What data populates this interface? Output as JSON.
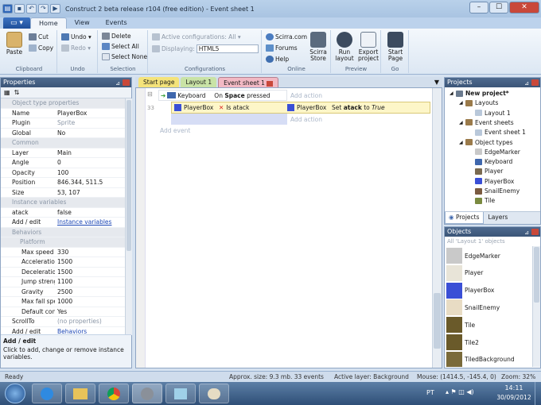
{
  "titlebar": {
    "title": "Construct 2 beta release r104  (free edition) - Event sheet 1",
    "minimize": "–",
    "maximize": "☐",
    "close": "✕"
  },
  "tabs": {
    "file": "▭ ▾",
    "items": [
      "Home",
      "View",
      "Events"
    ],
    "active": "Home"
  },
  "ribbon": {
    "clipboard": {
      "paste": "Paste",
      "cut": "Cut",
      "copy": "Copy",
      "label": "Clipboard"
    },
    "undo": {
      "undo": "Undo",
      "redo": "Redo",
      "label": "Undo"
    },
    "selection": {
      "delete": "Delete",
      "select_all": "Select All",
      "select_none": "Select None",
      "label": "Selection"
    },
    "configurations": {
      "active": "Active configurations: All",
      "displaying_label": "Displaying:",
      "displaying_value": "HTML5",
      "label": "Configurations"
    },
    "online": {
      "scirra": "Scirra.com",
      "forums": "Forums",
      "help": "Help",
      "store1": "Scirra",
      "store2": "Store",
      "label": "Online"
    },
    "preview": {
      "run1": "Run",
      "run2": "layout",
      "export1": "Export",
      "export2": "project",
      "label": "Preview"
    },
    "go": {
      "start1": "Start",
      "start2": "Page",
      "label": "Go"
    }
  },
  "properties": {
    "title": "Properties",
    "rows": [
      {
        "type": "cat",
        "k": "Object type properties"
      },
      {
        "k": "Name",
        "v": "PlayerBox"
      },
      {
        "k": "Plugin",
        "v": "Sprite",
        "gray": true
      },
      {
        "k": "Global",
        "v": "No"
      },
      {
        "type": "cat",
        "k": "Common"
      },
      {
        "k": "Layer",
        "v": "Main"
      },
      {
        "k": "Angle",
        "v": "0"
      },
      {
        "k": "Opacity",
        "v": "100"
      },
      {
        "k": "Position",
        "v": "846.344, 511.5"
      },
      {
        "k": "Size",
        "v": "53, 107"
      },
      {
        "type": "cat",
        "k": "Instance variables"
      },
      {
        "k": "atack",
        "v": "false"
      },
      {
        "k": "Add / edit",
        "v": "Instance variables",
        "link": true
      },
      {
        "type": "cat",
        "k": "Behaviors"
      },
      {
        "type": "subcat",
        "k": "Platform"
      },
      {
        "k": "Max speed",
        "v": "330",
        "sub": true
      },
      {
        "k": "Acceleration",
        "v": "1500",
        "sub": true
      },
      {
        "k": "Deceleration",
        "v": "1500",
        "sub": true
      },
      {
        "k": "Jump strength",
        "v": "1100",
        "sub": true
      },
      {
        "k": "Gravity",
        "v": "2500",
        "sub": true
      },
      {
        "k": "Max fall speed",
        "v": "1000",
        "sub": true
      },
      {
        "k": "Default contr...",
        "v": "Yes",
        "sub": true
      },
      {
        "k": "ScrollTo",
        "v": "(no properties)",
        "gray": true
      },
      {
        "k": "Add / edit",
        "v": "Behaviors",
        "link": true
      }
    ],
    "desc_title": "Add / edit",
    "desc_text": "Click to add, change or remove instance variables."
  },
  "event_tabs": [
    {
      "label": "Start page",
      "color": "#f4e37a"
    },
    {
      "label": "Layout 1",
      "color": "#c9e3a6"
    },
    {
      "label": "Event sheet 1",
      "color": "#f2b9c4",
      "active": true
    }
  ],
  "event_sheet": {
    "row1_num": "",
    "cond1_obj": "Keyboard",
    "cond1_text_pre": "On ",
    "cond1_text_bold": "Space",
    "cond1_text_post": " pressed",
    "add_action_1": "Add action",
    "row2_num": "33",
    "cond2_obj": "PlayerBox",
    "cond2_text": "Is atack",
    "act_obj": "PlayerBox",
    "act_pre": "Set ",
    "act_bold": "atack",
    "act_mid": " to ",
    "act_italic": "True",
    "add_action_2": "Add action",
    "add_event": "Add event"
  },
  "projects": {
    "title": "Projects",
    "items": [
      {
        "label": "New project*",
        "level": 0,
        "bold": true
      },
      {
        "label": "Layouts",
        "level": 1
      },
      {
        "label": "Layout 1",
        "level": 2
      },
      {
        "label": "Event sheets",
        "level": 1
      },
      {
        "label": "Event sheet 1",
        "level": 2
      },
      {
        "label": "Object types",
        "level": 1
      },
      {
        "label": "EdgeMarker",
        "level": 2
      },
      {
        "label": "Keyboard",
        "level": 2
      },
      {
        "label": "Player",
        "level": 2
      },
      {
        "label": "PlayerBox",
        "level": 2
      },
      {
        "label": "SnailEnemy",
        "level": 2
      },
      {
        "label": "Tile",
        "level": 2
      }
    ],
    "bottom_tabs": [
      "Projects",
      "Layers"
    ]
  },
  "objects": {
    "title": "Objects",
    "filter": "All 'Layout 1' objects",
    "items": [
      "EdgeMarker",
      "Player",
      "PlayerBox",
      "SnailEnemy",
      "Tile",
      "Tile2",
      "TiledBackground"
    ]
  },
  "status": {
    "ready": "Ready",
    "size": "Approx. size: 9.3 mb. 33 events",
    "layer": "Active layer: Background",
    "mouse": "Mouse: (1414.5, -145.4, 0)",
    "zoom": "Zoom: 32%"
  },
  "taskbar": {
    "lang": "PT",
    "time": "14:11",
    "date": "30/09/2012"
  },
  "colors": {
    "accent": "#3b5578",
    "selected_row": "#fdf6c8",
    "playerbox": "#3a4fd6"
  }
}
